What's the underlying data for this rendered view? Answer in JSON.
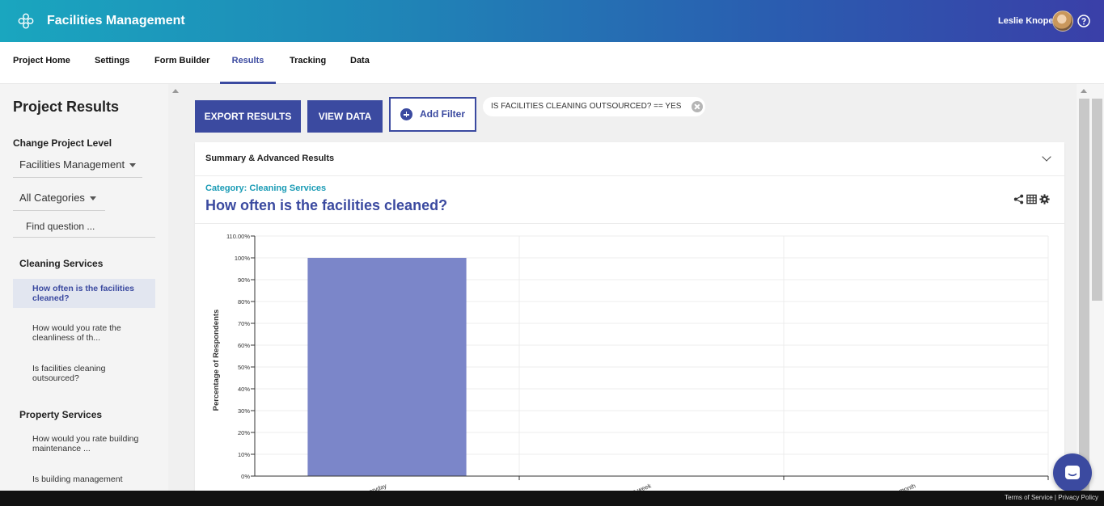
{
  "header": {
    "app_title": "Facilities Management",
    "user_name": "Leslie Knope",
    "gradient_start": "#1aa6bf",
    "gradient_end": "#3a3fa8"
  },
  "tabs": [
    {
      "label": "Project Home"
    },
    {
      "label": "Settings"
    },
    {
      "label": "Form Builder"
    },
    {
      "label": "Results",
      "active": true
    },
    {
      "label": "Tracking"
    },
    {
      "label": "Data"
    }
  ],
  "sidebar": {
    "title": "Project Results",
    "level_label": "Change Project Level",
    "level_value": "Facilities Management",
    "category_filter": "All Categories",
    "find_placeholder": "Find question ...",
    "groups": [
      {
        "name": "Cleaning Services",
        "questions": [
          {
            "label": "How often is the facilities cleaned?",
            "active": true
          },
          {
            "label": "How would you rate the cleanliness of th..."
          },
          {
            "label": "Is facilities cleaning outsourced?"
          }
        ]
      },
      {
        "name": "Property Services",
        "questions": [
          {
            "label": "How would you rate building maintenance ..."
          },
          {
            "label": "Is building management"
          }
        ]
      }
    ]
  },
  "toolbar": {
    "export_label": "EXPORT RESULTS",
    "view_data_label": "VIEW DATA",
    "add_filter_label": "Add Filter",
    "filter_chip": "IS FACILITIES CLEANING OUTSOURCED? == YES"
  },
  "card": {
    "header_label": "Summary & Advanced Results",
    "category": "Category: Cleaning Services",
    "question_title": "How often is the facilities cleaned?",
    "icons": [
      "share-icon",
      "table-icon",
      "gear-icon"
    ]
  },
  "chart_data": {
    "type": "bar",
    "categories": [
      "Everyday",
      "Once a week",
      "Once a month"
    ],
    "values": [
      100,
      0,
      0
    ],
    "ylabel": "Percentage of Respondents",
    "ylim": [
      0,
      110
    ],
    "yticks": [
      "0%",
      "10%",
      "20%",
      "30%",
      "40%",
      "50%",
      "60%",
      "70%",
      "80%",
      "90%",
      "100%",
      "110.00%"
    ],
    "bar_color": "#7b86c9",
    "grid": true
  },
  "footer": {
    "terms": "Terms of Service",
    "privacy": "Privacy Policy"
  },
  "colors": {
    "accent": "#3b4aa0",
    "category": "#1a9bb5"
  }
}
